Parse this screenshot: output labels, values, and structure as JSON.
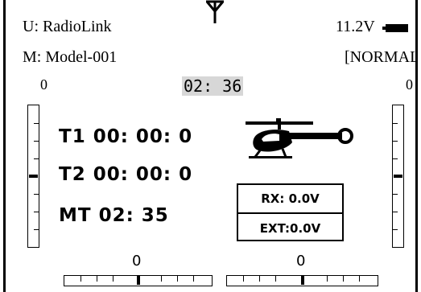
{
  "header": {
    "user_label": "U: RadioLink",
    "model_label": "M: Model-001",
    "voltage": "11.2V",
    "mode": "[NORMAL]",
    "antenna_icon": "antenna-icon",
    "battery_icon": "battery-icon"
  },
  "session_time": "02: 36",
  "side_trims": {
    "left_value": "0",
    "right_value": "0",
    "left_level": 0.5,
    "right_level": 0.5
  },
  "timers": {
    "t1": "T1 00: 00: 0",
    "t2": "T2 00: 00: 0",
    "mt": "MT 02: 35"
  },
  "model_icon": "helicopter-icon",
  "receiver": {
    "rx": "RX: 0.0V",
    "ext": "EXT:0.0V"
  },
  "bottom_trims": {
    "left_value": "0",
    "right_value": "0",
    "left_level": 0.5,
    "right_level": 0.5
  }
}
